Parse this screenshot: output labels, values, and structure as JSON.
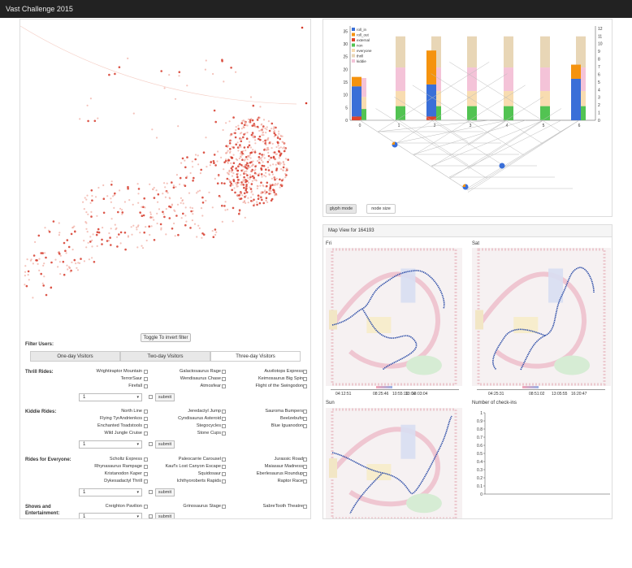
{
  "app": {
    "title": "Vast Challenge 2015"
  },
  "scatter": {
    "toggle_label": "Toggle To invert filter"
  },
  "filter": {
    "title": "Filter Users:",
    "tabs": [
      "One-day Visitors",
      "Two-day Visitors",
      "Three-day Visitors"
    ],
    "active_tab": "Three-day Visitors",
    "submit_label": "submit",
    "select_value": "1",
    "categories": [
      {
        "label": "Thrill Rides:",
        "rides": [
          "Wrightiraptor Mountain",
          "Galactosaurus Rage",
          "Auvilotops Express",
          "TerrorSaur",
          "Wendisaurus Chase",
          "Keimosaurus Big Spin",
          "Firefall",
          "Atmosfear",
          "Flight of the Swingodon"
        ]
      },
      {
        "label": "Kiddie Rides:",
        "rides": [
          "North Line",
          "Jeredactyl Jump",
          "Sauroma Bumpers",
          "Flying TyrAndrienkos",
          "Cyndisaurus Asteroid",
          "Beelzebufo",
          "Enchanted Toadstools",
          "Stegocycles",
          "Blue Iguanodon",
          "Wild Jungle Cruise",
          "Stone Cups"
        ]
      },
      {
        "label": "Rides for Everyone:",
        "rides": [
          "Scholtz Express",
          "Paleocarrie Carousel",
          "Jurassic Road",
          "Rhynasaurus Rampage",
          "Kauf's Lost Canyon Escape",
          "Maiasaur Madness",
          "Kristanodon Kaper",
          "Squidosaur",
          "Eberlesaurus Roundup",
          "Dykesadactyl Thrill",
          "Ichthyoroberts Rapids",
          "Raptor Race"
        ]
      },
      {
        "label": "Shows and Entertainment:",
        "rides": [
          "Creighton Pavilion",
          "Grinosaurus Stage",
          "SabreTooth Theatre"
        ]
      }
    ]
  },
  "glyph": {
    "legend": [
      "roll_in",
      "roll_out",
      "external",
      "non",
      "everyone",
      "thrill",
      "kiddie"
    ],
    "colors": {
      "roll_in": "#3a6fd8",
      "roll_out": "#f5930e",
      "external": "#e0432a",
      "non": "#52c352",
      "everyone": "#f8dcb0",
      "thrill": "#e8d6b6",
      "kiddie": "#f4c3d8"
    },
    "x_ticks": [
      "0",
      "1",
      "2",
      "3",
      "4",
      "5",
      "6"
    ],
    "left_ticks": [
      "0",
      "5",
      "10",
      "15",
      "20",
      "25",
      "30",
      "35"
    ],
    "right_ticks": [
      "0",
      "1",
      "2",
      "3",
      "4",
      "5",
      "6",
      "7",
      "8",
      "9",
      "10",
      "11",
      "12"
    ],
    "glyph_mode_label": "glyph mode",
    "node_size_label": "node size"
  },
  "map": {
    "header": "Map View for 164193",
    "days": [
      "Fri",
      "Sat",
      "Sun"
    ],
    "fri_times": [
      "04:12:51",
      "08:25:46",
      "10:55:19",
      "13:04",
      "13:03:04"
    ],
    "sat_times": [
      "04:25:31",
      "08:51:02",
      "13:05:55",
      "16:20:47"
    ],
    "checkins_title": "Number of check-ins",
    "checkins_ticks": [
      "0",
      "0.1",
      "0.2",
      "0.3",
      "0.4",
      "0.5",
      "0.6",
      "0.7",
      "0.8",
      "0.9",
      "1"
    ]
  }
}
